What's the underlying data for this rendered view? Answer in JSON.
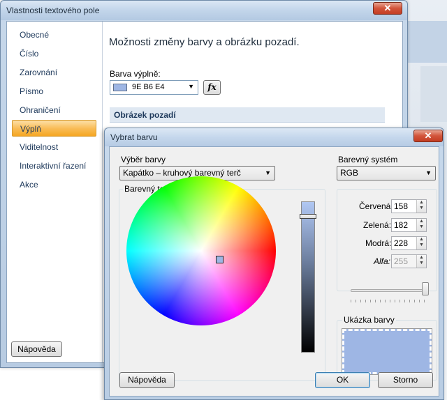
{
  "main_window": {
    "title": "Vlastnosti textového pole",
    "close_glyph": "✕",
    "nav": {
      "items": [
        {
          "label": "Obecné"
        },
        {
          "label": "Číslo"
        },
        {
          "label": "Zarovnání"
        },
        {
          "label": "Písmo"
        },
        {
          "label": "Ohraničení"
        },
        {
          "label": "Výplň",
          "active": true
        },
        {
          "label": "Viditelnost"
        },
        {
          "label": "Interaktivní řazení"
        },
        {
          "label": "Akce"
        }
      ],
      "help_label": "Nápověda"
    },
    "content": {
      "heading": "Možnosti změny barvy a obrázku pozadí.",
      "fill_color_label": "Barva výplně:",
      "fill_color_value": "9E B6 E4",
      "fill_color_hex": "#9EB6E4",
      "fx_label": "fx",
      "background_image_section": "Obrázek pozadí"
    }
  },
  "color_dialog": {
    "title": "Vybrat barvu",
    "close_glyph": "✕",
    "color_picker_label": "Výběr barvy",
    "color_picker_value": "Kapátko – kruhový barevný terč",
    "color_system_label": "Barevný systém",
    "color_system_value": "RGB",
    "wheel_label": "Barevný terč",
    "fields": {
      "red_label": "Červená:",
      "red_value": "158",
      "green_label": "Zelená:",
      "green_value": "182",
      "blue_label": "Modrá:",
      "blue_value": "228",
      "alpha_label": "Alfa:",
      "alpha_value": "255"
    },
    "alpha_slider_level": 1.0,
    "sample_label": "Ukázka barvy",
    "sample_color": "#9EB6E4",
    "buttons": {
      "help": "Nápověda",
      "ok": "OK",
      "cancel": "Storno"
    }
  },
  "icons": {
    "dropdown_arrow": "▼",
    "spin_up": "▲",
    "spin_down": "▼"
  }
}
